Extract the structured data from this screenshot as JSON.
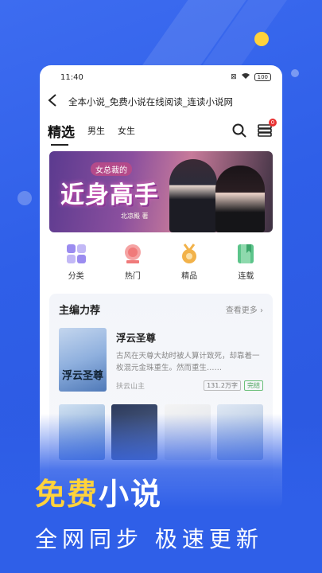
{
  "status": {
    "time": "11:40",
    "battery": "100"
  },
  "url_bar": {
    "title": "全本小说_免费小说在线阅读_连读小说网"
  },
  "tabs": [
    {
      "label": "精选"
    },
    {
      "label": "男生"
    },
    {
      "label": "女生"
    }
  ],
  "notification_badge": "0",
  "banner": {
    "subtitle": "女总裁的",
    "title": "近身高手",
    "author": "北凉殿 著"
  },
  "categories": [
    {
      "label": "分类",
      "icon": "grid-icon",
      "color": "#9b8cf0"
    },
    {
      "label": "热门",
      "icon": "flame-badge-icon",
      "color": "#f07a7a"
    },
    {
      "label": "精品",
      "icon": "medal-icon",
      "color": "#f2b24a"
    },
    {
      "label": "连载",
      "icon": "book-icon",
      "color": "#5cc48a"
    }
  ],
  "recommend": {
    "title": "主编力荐",
    "more": "查看更多",
    "book": {
      "cover_text": "浮云圣尊",
      "title": "浮云圣尊",
      "description": "古风在天尊大劫时被人算计致死，却靠着一枚混元金珠重生。然而重生……",
      "author": "扶云山主",
      "words": "131.2万字",
      "status": "完结"
    }
  },
  "slogan": {
    "highlight": "免费",
    "rest": "小说",
    "line2": "全网同步 极速更新"
  },
  "colors": {
    "accent": "#2f5fe8",
    "yellow": "#ffd23c"
  }
}
